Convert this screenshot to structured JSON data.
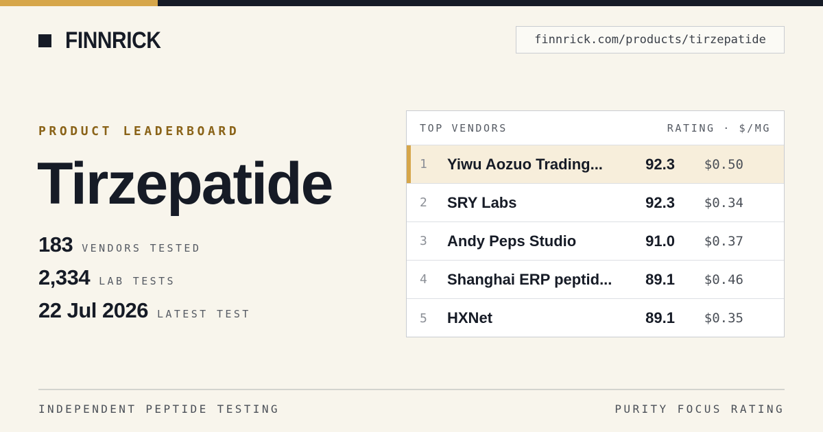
{
  "brand": {
    "name": "FINNRICK",
    "icon": "square-logo-icon"
  },
  "url": "finnrick.com/products/tirzepatide",
  "eyebrow": "PRODUCT LEADERBOARD",
  "product": "Tirzepatide",
  "stats": [
    {
      "value": "183",
      "label": "VENDORS TESTED"
    },
    {
      "value": "2,334",
      "label": "LAB TESTS"
    },
    {
      "value": "22 Jul 2026",
      "label": "LATEST TEST"
    }
  ],
  "leaderboard": {
    "header_left": "TOP VENDORS",
    "header_right": "RATING · $/MG",
    "rows": [
      {
        "rank": "1",
        "vendor": "Yiwu Aozuo Trading...",
        "rating": "92.3",
        "price": "$0.50"
      },
      {
        "rank": "2",
        "vendor": "SRY Labs",
        "rating": "92.3",
        "price": "$0.34"
      },
      {
        "rank": "3",
        "vendor": "Andy Peps Studio",
        "rating": "91.0",
        "price": "$0.37"
      },
      {
        "rank": "4",
        "vendor": "Shanghai ERP peptid...",
        "rating": "89.1",
        "price": "$0.46"
      },
      {
        "rank": "5",
        "vendor": "HXNet",
        "rating": "89.1",
        "price": "$0.35"
      }
    ]
  },
  "footer": {
    "left": "INDEPENDENT PEPTIDE TESTING",
    "right": "PURITY FOCUS RATING"
  },
  "colors": {
    "accent": "#d6a64a",
    "dark": "#161b26",
    "background": "#f8f5ec",
    "eyebrow": "#8a6318"
  }
}
